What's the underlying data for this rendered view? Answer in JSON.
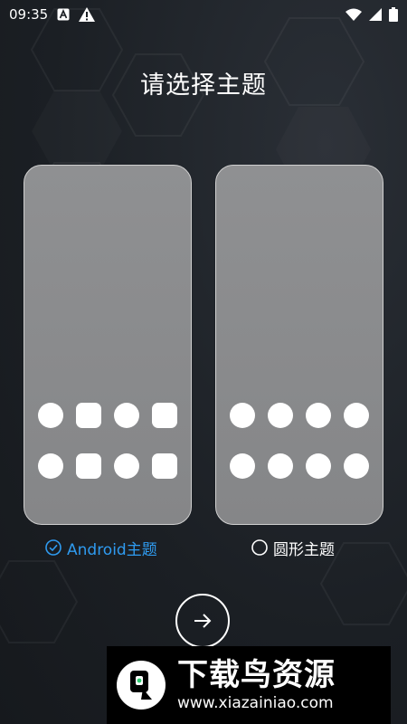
{
  "status_bar": {
    "time": "09:35",
    "icons": [
      "font-notification-icon",
      "warning-icon",
      "wifi-icon",
      "signal-icon",
      "battery-icon"
    ]
  },
  "title": "请选择主题",
  "themes": [
    {
      "label": "Android主题",
      "selected": true,
      "icons": [
        "circle",
        "square",
        "circle",
        "square",
        "circle",
        "square",
        "circle",
        "square"
      ]
    },
    {
      "label": "圆形主题",
      "selected": false,
      "icons": [
        "circle",
        "circle",
        "circle",
        "circle",
        "circle",
        "circle",
        "circle",
        "circle"
      ]
    }
  ],
  "next_button": {
    "icon": "arrow-right-icon"
  },
  "watermark": {
    "title": "下载鸟资源",
    "url": "www.xiazainiao.com"
  },
  "colors": {
    "selected_accent": "#2f9bf0",
    "card_fill": "#8a8b8d",
    "background": "#1b1f24"
  }
}
